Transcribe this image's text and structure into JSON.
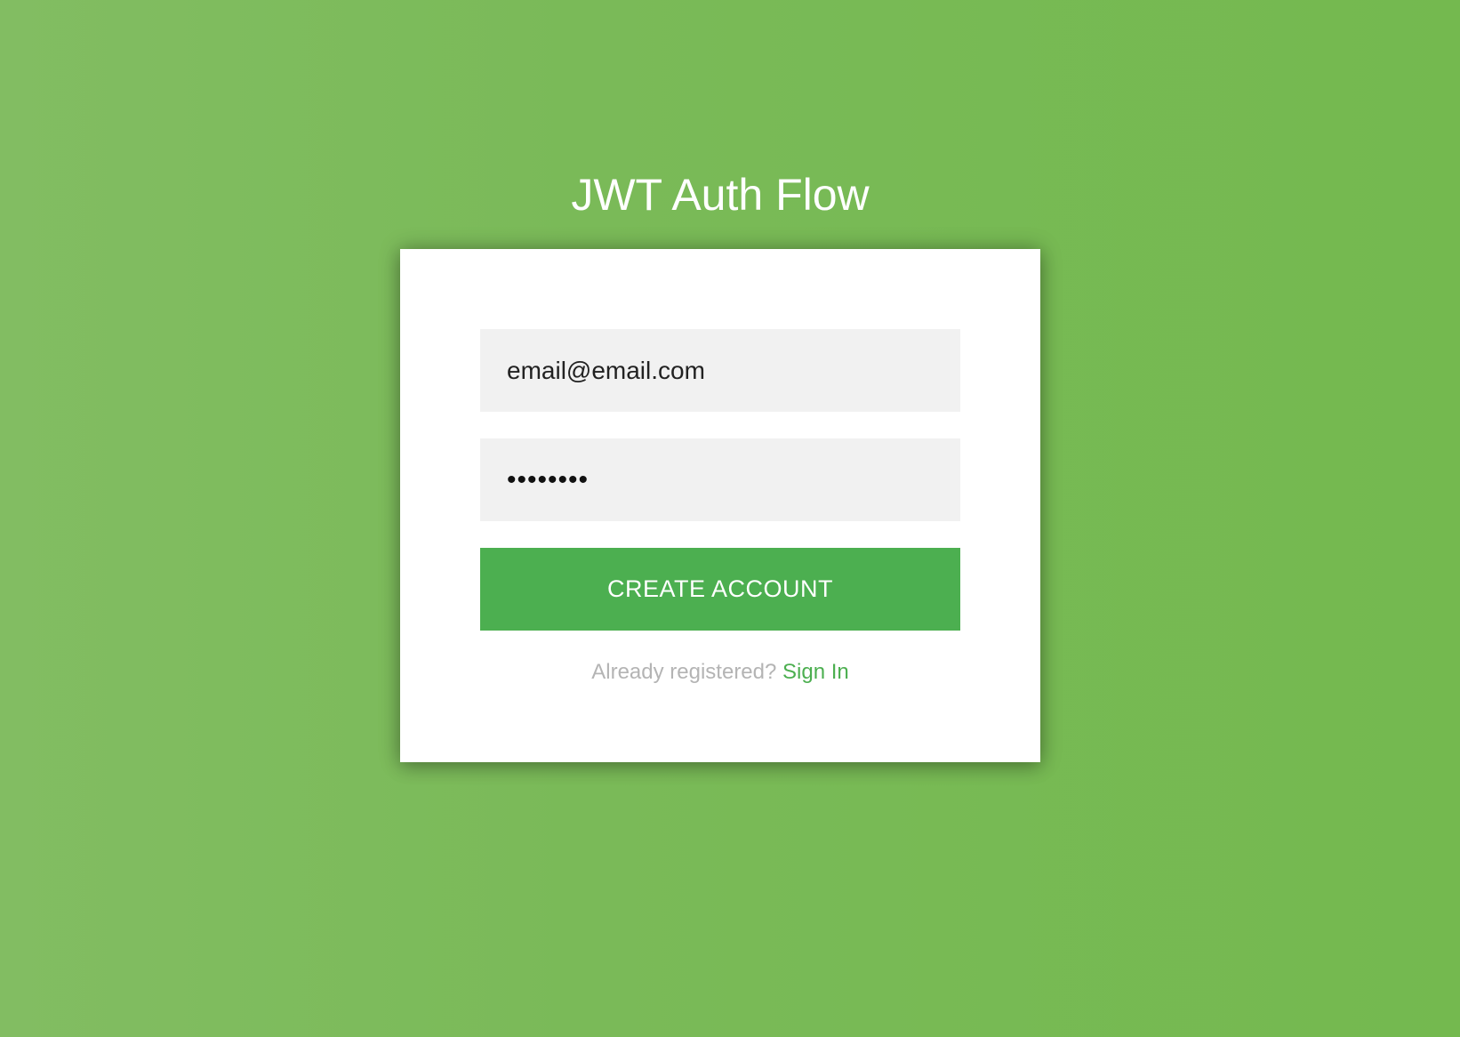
{
  "app": {
    "title": "JWT Auth Flow"
  },
  "form": {
    "email_value": "email@email.com",
    "password_value": "••••••••",
    "submit_label": "CREATE ACCOUNT",
    "footer_text": "Already registered?",
    "signin_label": "Sign In"
  },
  "colors": {
    "background": "#7aba58",
    "card": "#ffffff",
    "field_background": "#f1f1f1",
    "accent": "#4caf50",
    "muted_text": "#b4b4b4"
  }
}
